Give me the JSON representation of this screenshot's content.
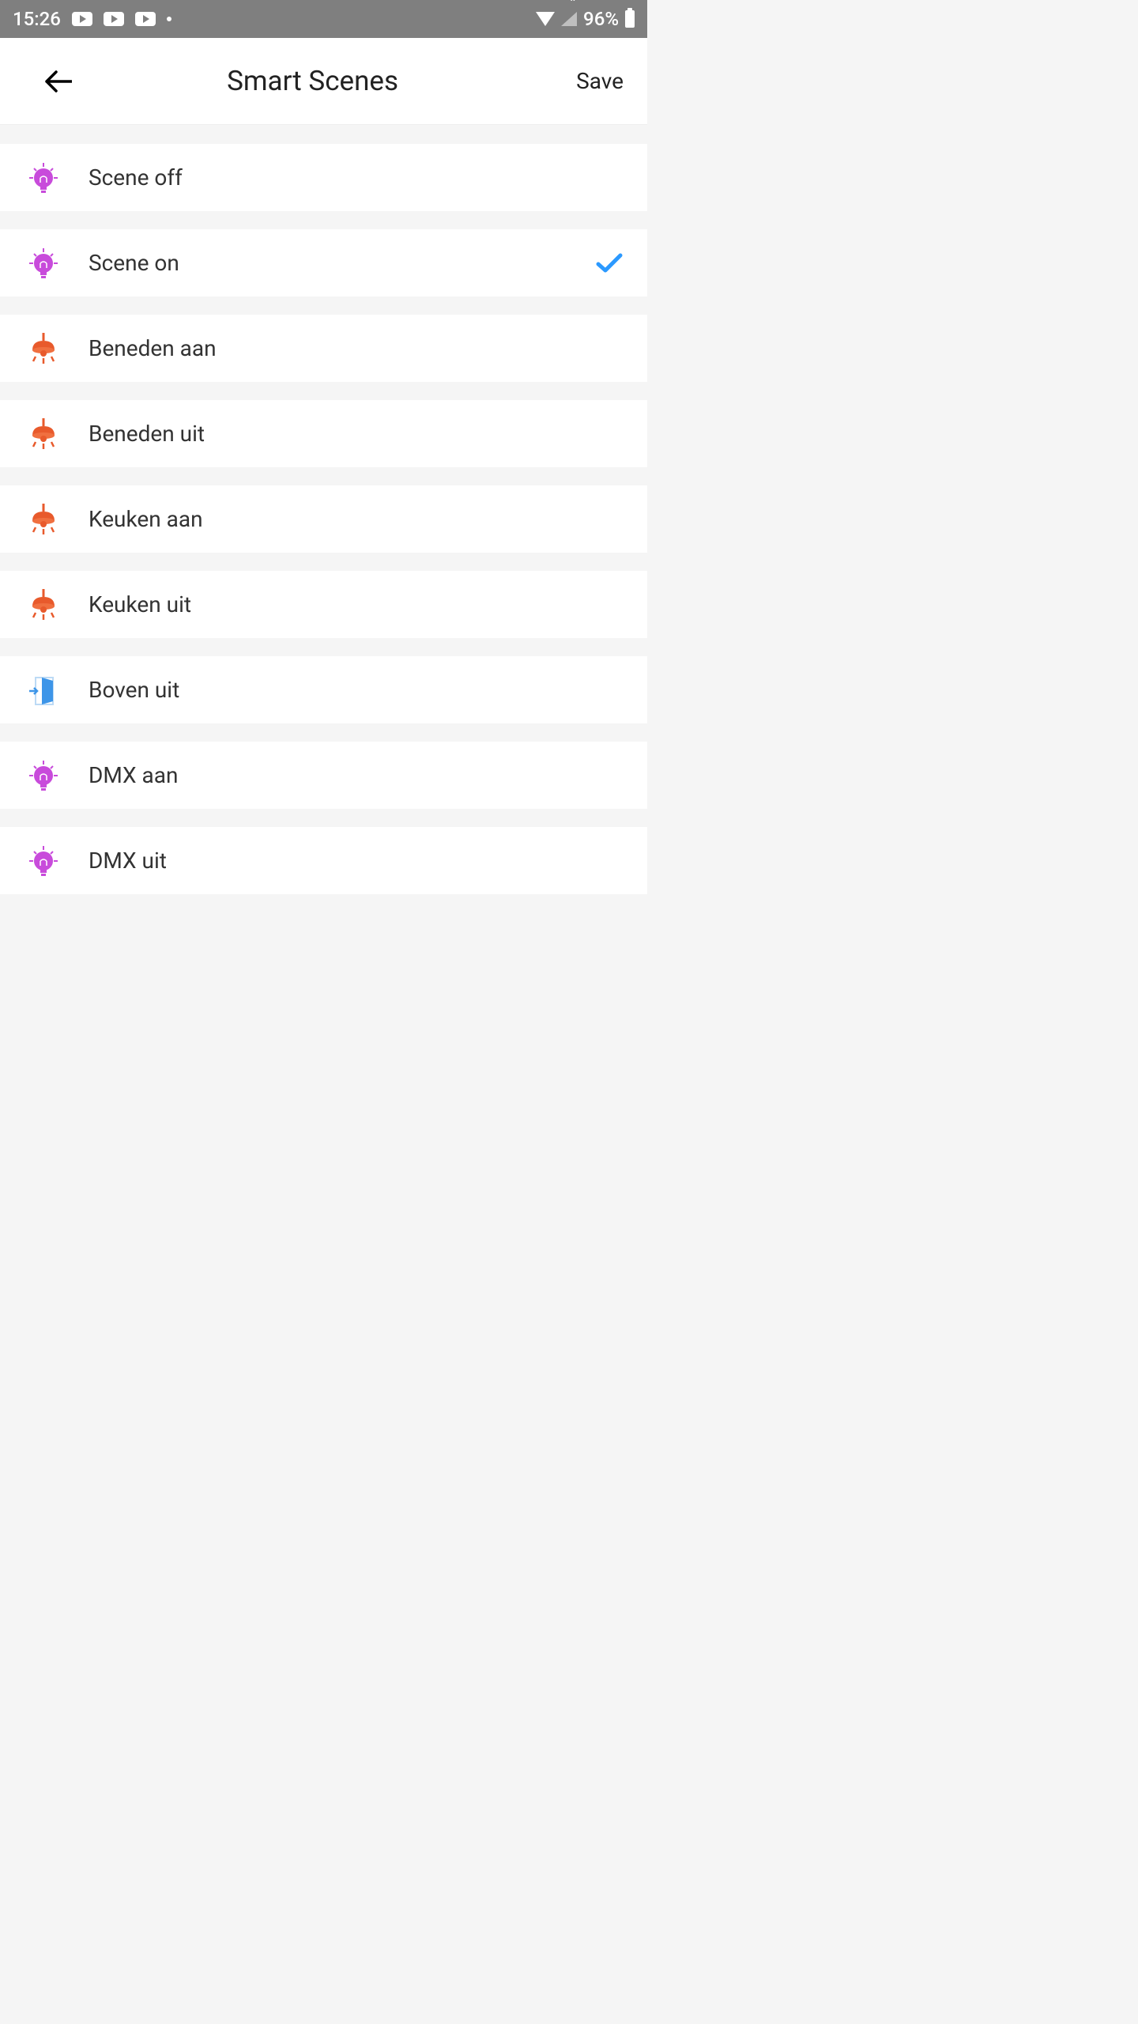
{
  "status_bar": {
    "time": "15:26",
    "battery_percent": "96%"
  },
  "header": {
    "title": "Smart Scenes",
    "save_label": "Save"
  },
  "scenes": [
    {
      "label": "Scene off",
      "icon": "bulb-purple",
      "selected": false
    },
    {
      "label": "Scene on",
      "icon": "bulb-purple",
      "selected": true
    },
    {
      "label": "Beneden aan",
      "icon": "lamp-orange",
      "selected": false
    },
    {
      "label": "Beneden uit",
      "icon": "lamp-orange",
      "selected": false
    },
    {
      "label": "Keuken aan",
      "icon": "lamp-orange",
      "selected": false
    },
    {
      "label": "Keuken uit",
      "icon": "lamp-orange",
      "selected": false
    },
    {
      "label": "Boven uit",
      "icon": "door-blue",
      "selected": false
    },
    {
      "label": "DMX aan",
      "icon": "bulb-purple",
      "selected": false
    },
    {
      "label": "DMX uit",
      "icon": "bulb-purple",
      "selected": false
    }
  ]
}
